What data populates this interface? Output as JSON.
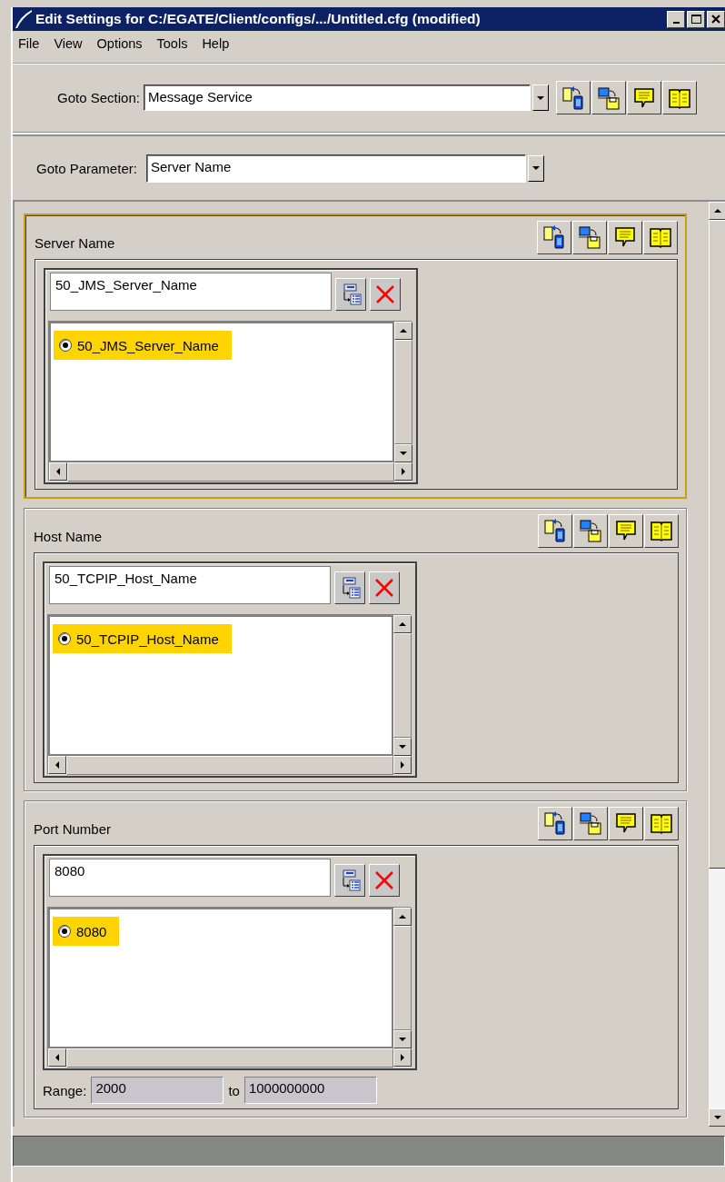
{
  "window": {
    "title": "Edit Settings for C:/EGATE/Client/configs/.../Untitled.cfg (modified)"
  },
  "menu": [
    "File",
    "View",
    "Options",
    "Tools",
    "Help"
  ],
  "goto_section": {
    "label": "Goto Section:",
    "value": "Message Service"
  },
  "goto_parameter": {
    "label": "Goto Parameter:",
    "value": "Server Name"
  },
  "parameters": [
    {
      "name": "Server Name",
      "focused": true,
      "value": "50_JMS_Server_Name",
      "options": [
        {
          "label": "50_JMS_Server_Name",
          "selected": true
        }
      ]
    },
    {
      "name": "Host Name",
      "focused": false,
      "value": "50_TCPIP_Host_Name",
      "options": [
        {
          "label": "50_TCPIP_Host_Name",
          "selected": true
        }
      ]
    },
    {
      "name": "Port Number",
      "focused": false,
      "value": "8080",
      "options": [
        {
          "label": "8080",
          "selected": true
        }
      ],
      "range": {
        "label": "Range:",
        "min": "2000",
        "separator": "to",
        "max": "1000000000"
      }
    }
  ]
}
